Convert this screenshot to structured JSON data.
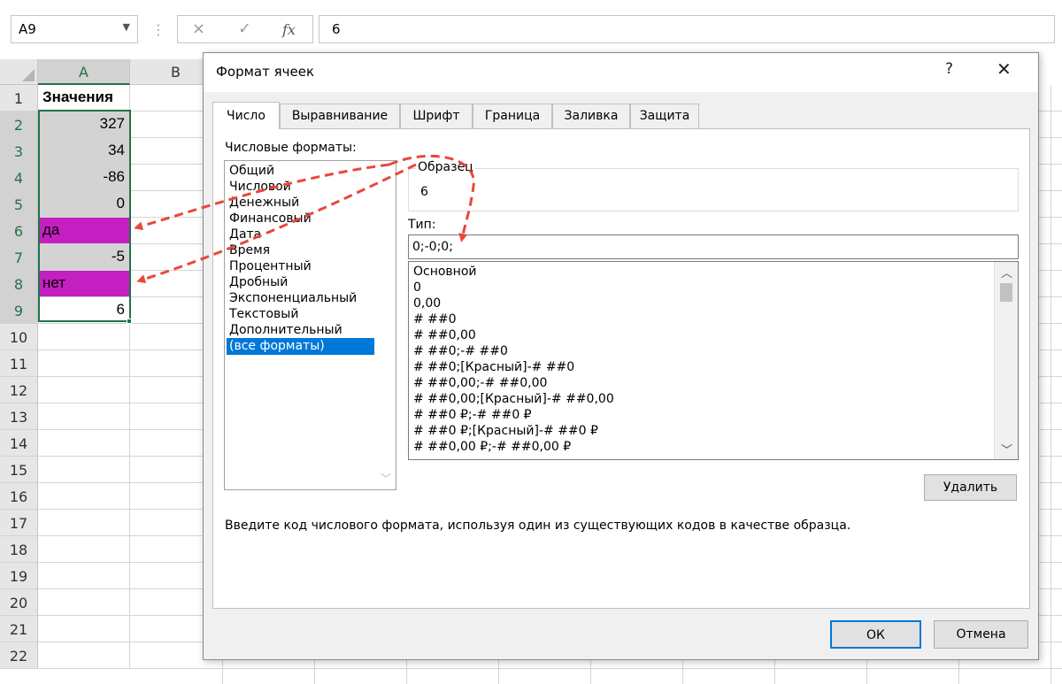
{
  "formula_bar": {
    "name_box": "A9",
    "cancel_icon": "×",
    "enter_icon": "✓",
    "fx_label": "fx",
    "formula": "6"
  },
  "grid": {
    "columns": [
      "A",
      "B"
    ],
    "rows": [
      {
        "num": "1",
        "a": "Значения"
      },
      {
        "num": "2",
        "a": "327"
      },
      {
        "num": "3",
        "a": "34"
      },
      {
        "num": "4",
        "a": "-86"
      },
      {
        "num": "5",
        "a": "0"
      },
      {
        "num": "6",
        "a": "да"
      },
      {
        "num": "7",
        "a": "-5"
      },
      {
        "num": "8",
        "a": "нет"
      },
      {
        "num": "9",
        "a": "6"
      },
      {
        "num": "10",
        "a": ""
      },
      {
        "num": "11",
        "a": ""
      },
      {
        "num": "12",
        "a": ""
      },
      {
        "num": "13",
        "a": ""
      },
      {
        "num": "14",
        "a": ""
      },
      {
        "num": "15",
        "a": ""
      },
      {
        "num": "16",
        "a": ""
      },
      {
        "num": "17",
        "a": ""
      },
      {
        "num": "18",
        "a": ""
      },
      {
        "num": "19",
        "a": ""
      },
      {
        "num": "20",
        "a": ""
      },
      {
        "num": "21",
        "a": ""
      },
      {
        "num": "22",
        "a": ""
      }
    ],
    "colors": {
      "highlight_gray": "#d3d3d3",
      "highlight_magenta": "#c41fc1",
      "selection_green": "#217346"
    }
  },
  "dialog": {
    "title": "Формат ячеек",
    "help": "?",
    "close": "✕",
    "tabs": [
      "Число",
      "Выравнивание",
      "Шрифт",
      "Граница",
      "Заливка",
      "Защита"
    ],
    "active_tab": "Число",
    "categories_label": "Числовые форматы:",
    "categories": [
      "Общий",
      "Числовой",
      "Денежный",
      "Финансовый",
      "Дата",
      "Время",
      "Процентный",
      "Дробный",
      "Экспоненциальный",
      "Текстовый",
      "Дополнительный",
      "(все форматы)"
    ],
    "selected_category": "(все форматы)",
    "sample_label": "Образец",
    "sample_value": "6",
    "type_label": "Тип:",
    "type_value": "0;-0;0;",
    "format_codes": [
      "Основной",
      "0",
      "0,00",
      "# ##0",
      "# ##0,00",
      "# ##0;-# ##0",
      "# ##0;[Красный]-# ##0",
      "# ##0,00;-# ##0,00",
      "# ##0,00;[Красный]-# ##0,00",
      "# ##0 ₽;-# ##0 ₽",
      "# ##0 ₽;[Красный]-# ##0 ₽",
      "# ##0,00 ₽;-# ##0,00 ₽"
    ],
    "delete_button": "Удалить",
    "hint": "Введите код числового формата, используя один из существующих кодов в качестве образца.",
    "ok_button": "ОК",
    "cancel_button": "Отмена",
    "accent_color": "#0078d7"
  },
  "annotation": {
    "arrow_color": "#e8473b"
  }
}
